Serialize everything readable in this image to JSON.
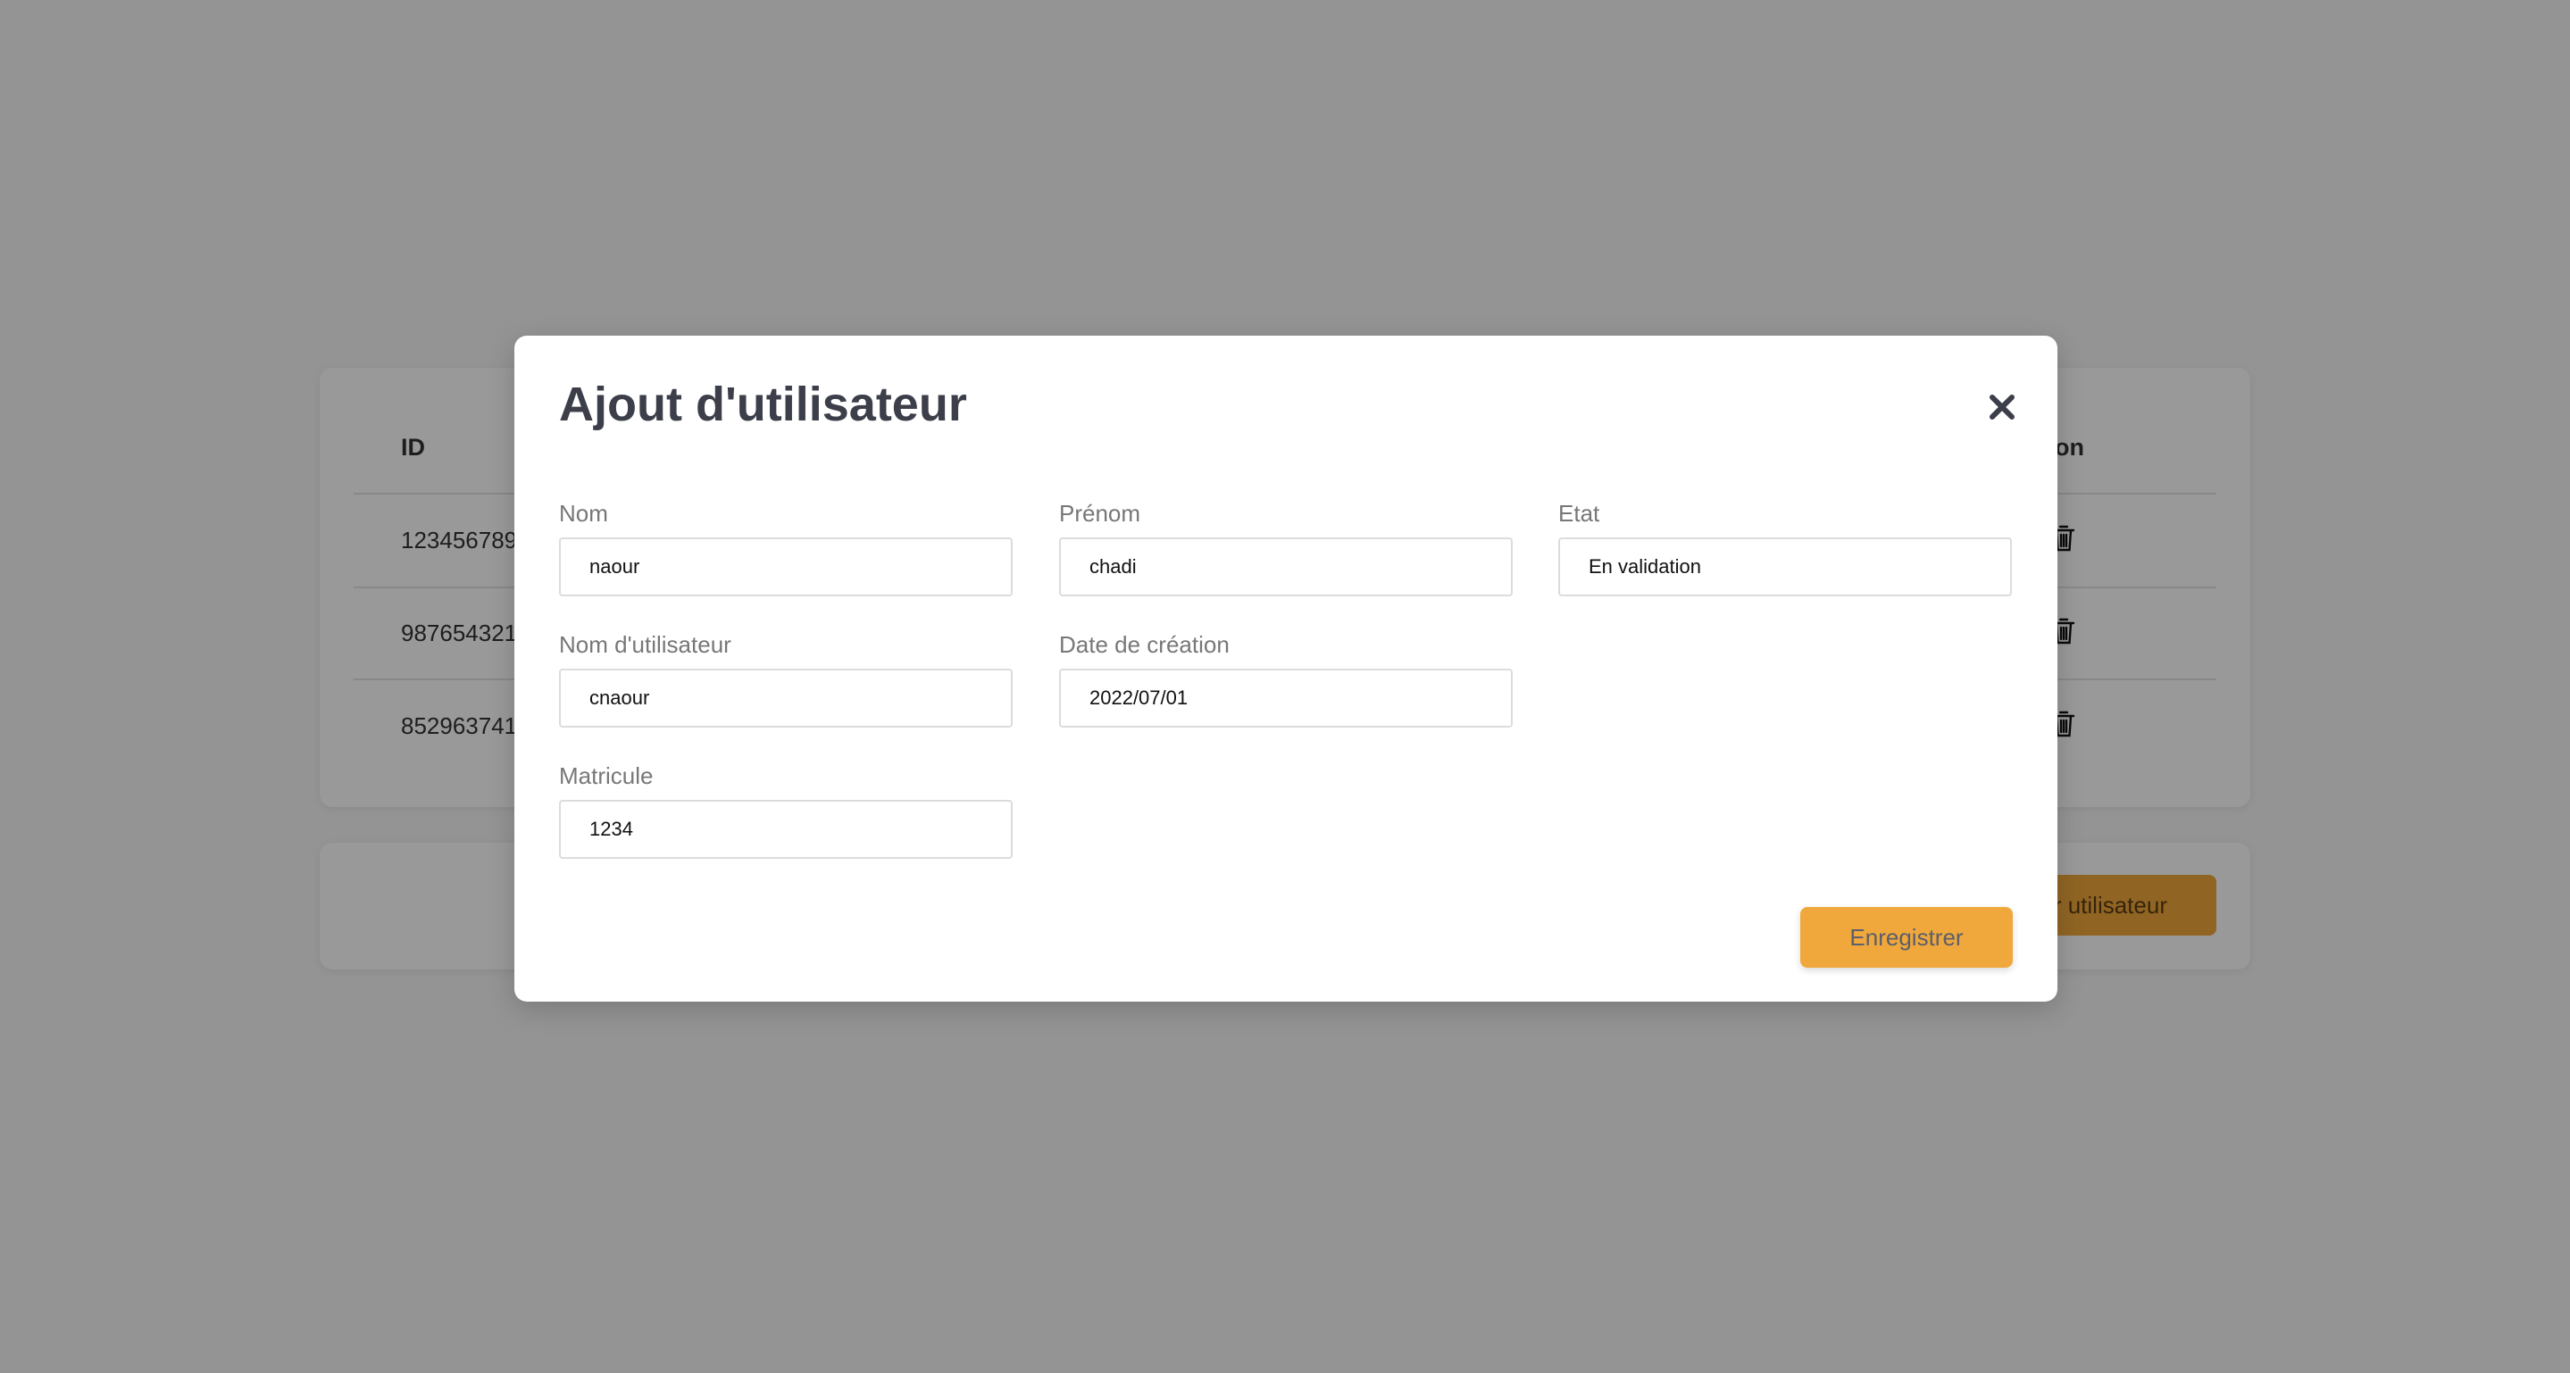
{
  "table": {
    "headers": {
      "id": "ID",
      "action": "Action"
    },
    "rows": [
      {
        "id": "123456789"
      },
      {
        "id": "987654321"
      },
      {
        "id": "852963741"
      }
    ]
  },
  "footer": {
    "add_button": "Ajouter utilisateur"
  },
  "modal": {
    "title": "Ajout d'utilisateur",
    "fields": {
      "nom": {
        "label": "Nom",
        "value": "naour"
      },
      "prenom": {
        "label": "Prénom",
        "value": "chadi"
      },
      "etat": {
        "label": "Etat",
        "value": "En validation"
      },
      "username": {
        "label": "Nom d'utilisateur",
        "value": "cnaour"
      },
      "date": {
        "label": "Date de création",
        "value": "2022/07/01"
      },
      "matricule": {
        "label": "Matricule",
        "value": "1234"
      }
    },
    "save_label": "Enregistrer"
  },
  "colors": {
    "accent": "#f0a83c",
    "title": "#3c3f4a",
    "overlay": "rgba(0,0,0,0.4)"
  },
  "icons": {
    "close": "close-icon",
    "delete": "trash-icon"
  }
}
